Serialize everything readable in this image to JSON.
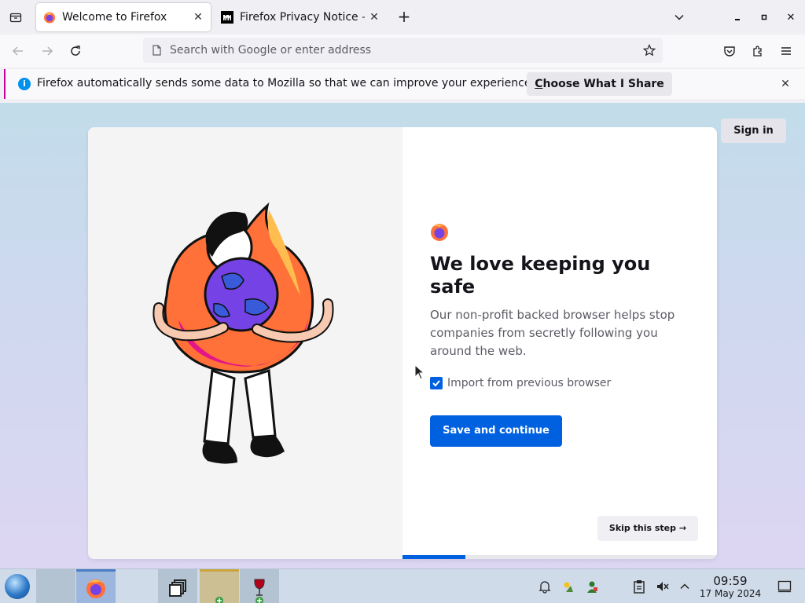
{
  "tabs": [
    {
      "title": "Welcome to Firefox",
      "active": true
    },
    {
      "title": "Firefox Privacy Notice —",
      "active": false
    }
  ],
  "urlbar": {
    "placeholder": "Search with Google or enter address"
  },
  "notification": {
    "message": "Firefox automatically sends some data to Mozilla so that we can improve your experience.",
    "action_first": "C",
    "action_rest": "hoose What I Share"
  },
  "header": {
    "signin_label": "Sign in"
  },
  "onboarding": {
    "title": "We love keeping you safe",
    "description": "Our non-profit backed browser helps stop companies from secretly following you around the web.",
    "import_label": "Import from previous browser",
    "import_checked": true,
    "primary_label": "Save and continue",
    "skip_label": "Skip this step →",
    "progress": 0.2
  },
  "taskbar": {
    "time": "09:59",
    "date": "17 May 2024"
  },
  "colors": {
    "accent": "#0061e0",
    "notification_border": "#c400a0"
  }
}
